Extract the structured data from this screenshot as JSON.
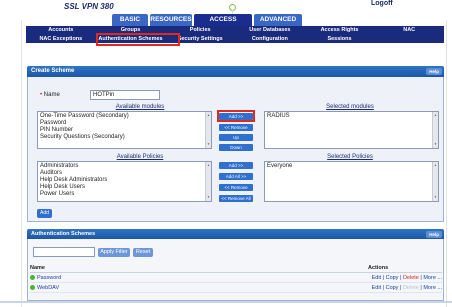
{
  "app": {
    "brand": "SSL VPN 380",
    "logoff": "Logoff"
  },
  "top_tabs": [
    "BASIC",
    "RESOURCES",
    "ACCESS CONTROL",
    "ADVANCED"
  ],
  "nav": {
    "row1": [
      "Accounts",
      "Groups",
      "Policies",
      "User Databases",
      "Access Rights",
      "NAC"
    ],
    "row2": [
      "NAC Exceptions",
      "Authentication Schemes",
      "Security Settings",
      "Configuration",
      "Sessions",
      ""
    ]
  },
  "create": {
    "title": "Create Scheme",
    "help": "Help",
    "name_label": "Name",
    "name_value": "HOTPin",
    "available_modules_label": "Available modules",
    "available_modules": [
      "One-Time Password (Secondary)",
      "Password",
      "PIN Number",
      "Security Questions (Secondary)"
    ],
    "selected_modules_label": "Selected modules",
    "selected_modules": [
      "RADIUS"
    ],
    "module_buttons": [
      "Add >>",
      "<< Remove",
      "Up",
      "Down"
    ],
    "available_policies_label": "Available Policies",
    "available_policies": [
      "Administrators",
      "Auditors",
      "Help Desk Administrators",
      "Help Desk Users",
      "Power Users"
    ],
    "selected_policies_label": "Selected Policies",
    "selected_policies": [
      "Everyone"
    ],
    "policy_buttons": [
      "Add >>",
      "Add All >>",
      "<< Remove",
      "<< Remove All"
    ],
    "add_button": "Add"
  },
  "schemes": {
    "title": "Authentication Schemes",
    "help": "Help",
    "filter_value": "",
    "apply_filter": "Apply Filter",
    "reset": "Reset",
    "col_name": "Name",
    "col_actions": "Actions",
    "rows": [
      {
        "name": "Password",
        "actions": [
          "Edit",
          "Copy",
          "Delete",
          "More ..."
        ]
      },
      {
        "name": "WebDAV",
        "actions": [
          "Edit",
          "Copy",
          "Delete",
          "More ..."
        ]
      }
    ]
  },
  "colors": {
    "accent": "#1b2c8f",
    "highlight": "#e0281f",
    "panel_header": "#2f74c6"
  }
}
